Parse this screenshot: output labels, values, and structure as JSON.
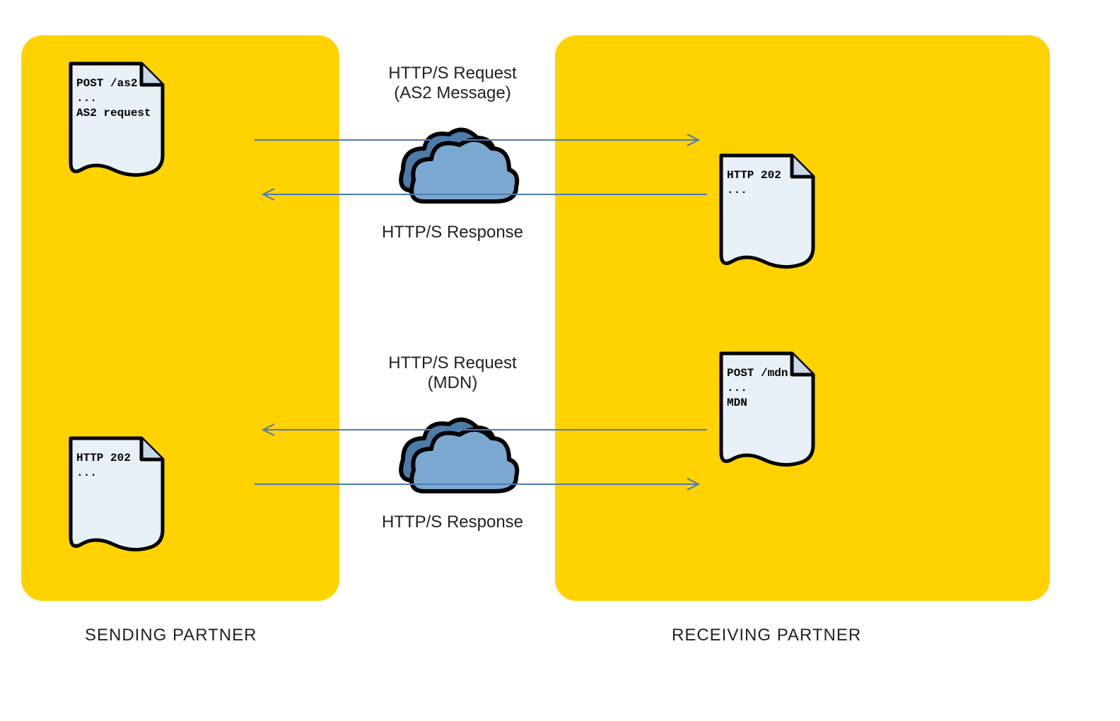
{
  "panels": {
    "left_label": "SENDING PARTNER",
    "right_label": "RECEIVING PARTNER"
  },
  "flows": {
    "top_request_line1": "HTTP/S Request",
    "top_request_line2": "(AS2 Message)",
    "top_response": "HTTP/S Response",
    "bottom_request_line1": "HTTP/S Request",
    "bottom_request_line2": "(MDN)",
    "bottom_response": "HTTP/S Response"
  },
  "documents": {
    "as2_request": "POST /as2\n...\nAS2 request",
    "http202_top": "HTTP 202\n...",
    "mdn_request": "POST /mdn\n...\nMDN",
    "http202_bottom": "HTTP 202\n..."
  },
  "colors": {
    "panel": "#ffd200",
    "doc_fill": "#e8f0f8",
    "cloud_fill": "#7aa8d0",
    "cloud_back": "#4d7ba8",
    "arrow": "#4d7bb3"
  }
}
